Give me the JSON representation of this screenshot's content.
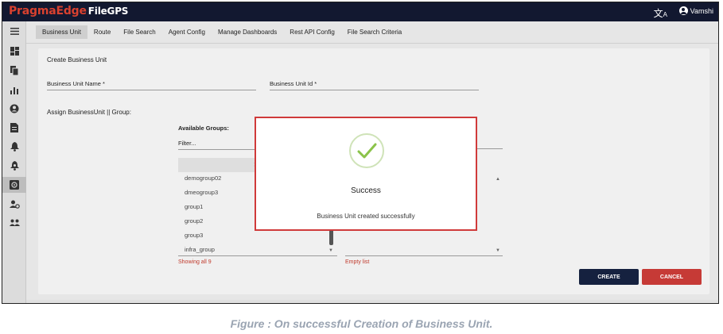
{
  "app": {
    "brand": "PragmaEdge",
    "product": "FileGPS",
    "username": "Vamshi"
  },
  "tabs": [
    "Business Unit",
    "Route",
    "File Search",
    "Agent Config",
    "Manage Dashboards",
    "Rest API Config",
    "File Search Criteria"
  ],
  "form": {
    "title": "Create Business Unit",
    "name_label": "Business Unit Name *",
    "id_label": "Business Unit Id *",
    "assign_label": "Assign BusinessUnit || Group:",
    "available_title": "Available Groups:",
    "filter_placeholder": "Filter...",
    "move_all_label": ">>",
    "groups": [
      "demogroup02",
      "dmeogroup3",
      "group1",
      "group2",
      "group3",
      "infra_group"
    ],
    "showing_text": "Showing all 9",
    "empty_text": "Empty list",
    "create_label": "CREATE",
    "cancel_label": "CANCEL"
  },
  "dialog": {
    "title": "Success",
    "message": "Business Unit created successfully"
  },
  "caption": "Figure : On successful Creation of Business Unit.",
  "colors": {
    "topbar": "#121830",
    "brand": "#d9412f",
    "create": "#15213f",
    "cancel": "#c63a36",
    "success": "#8bc34a",
    "dialog_border": "#d03a3a"
  },
  "sidebar_icons": [
    "menu-icon",
    "dashboard-icon",
    "copy-icon",
    "bar-chart-icon",
    "user-circle-icon",
    "document-icon",
    "bell-icon",
    "bell-settings-icon",
    "settings-box-icon",
    "user-settings-icon",
    "group-icon"
  ]
}
